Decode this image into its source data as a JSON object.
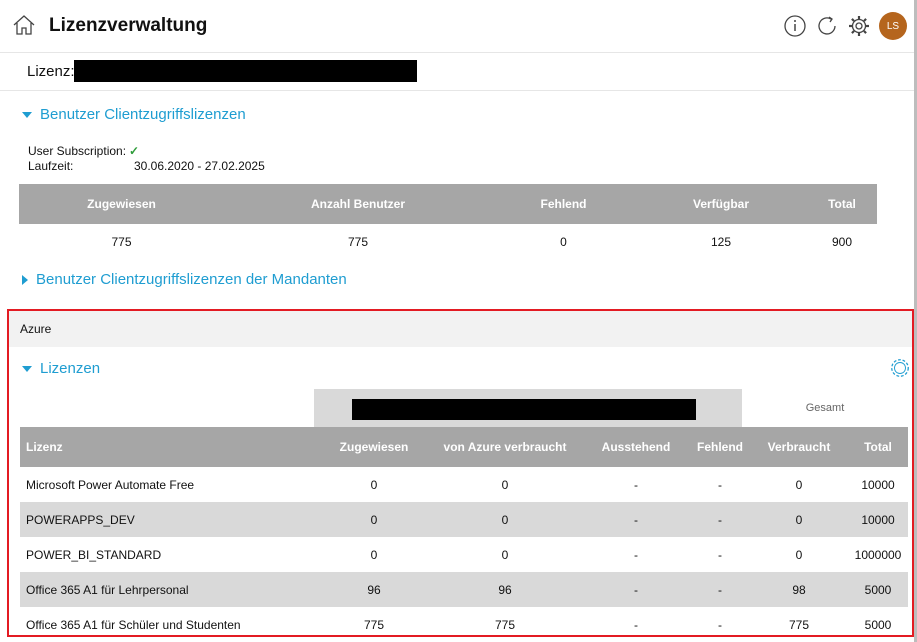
{
  "header": {
    "title": "Lizenzverwaltung",
    "avatar_initials": "LS"
  },
  "license": {
    "label": "Lizenz:"
  },
  "section_user_cal": {
    "title": "Benutzer Clientzugriffslizenzen",
    "subscription_label": "User Subscription:",
    "subscription_check": "✓",
    "runtime_label": "Laufzeit:",
    "runtime_value": "30.06.2020 - 27.02.2025",
    "columns": [
      "Zugewiesen",
      "Anzahl Benutzer",
      "Fehlend",
      "Verfügbar",
      "Total"
    ],
    "row": [
      "775",
      "775",
      "0",
      "125",
      "900"
    ]
  },
  "section_tenant_cal": {
    "title": "Benutzer Clientzugriffslizenzen der Mandanten"
  },
  "azure": {
    "title": "Azure",
    "licenses_title": "Lizenzen",
    "group_header": "Gesamt",
    "columns": [
      "Lizenz",
      "Zugewiesen",
      "von Azure verbraucht",
      "Ausstehend",
      "Fehlend",
      "Verbraucht",
      "Total"
    ],
    "rows": [
      [
        "Microsoft Power Automate Free",
        "0",
        "0",
        "-",
        "-",
        "0",
        "10000"
      ],
      [
        "POWERAPPS_DEV",
        "0",
        "0",
        "-",
        "-",
        "0",
        "10000"
      ],
      [
        "POWER_BI_STANDARD",
        "0",
        "0",
        "-",
        "-",
        "0",
        "1000000"
      ],
      [
        "Office 365 A1 für Lehrpersonal",
        "96",
        "96",
        "-",
        "-",
        "98",
        "5000"
      ],
      [
        "Office 365 A1 für Schüler und Studenten",
        "775",
        "775",
        "-",
        "-",
        "775",
        "5000"
      ]
    ]
  },
  "colors": {
    "accent": "#1f9dd1",
    "header_gray": "#a6a6a6",
    "row_alt": "#d9d9d9",
    "highlight_border": "#e31b23",
    "avatar": "#b5651d",
    "check": "#2e9c3a"
  }
}
